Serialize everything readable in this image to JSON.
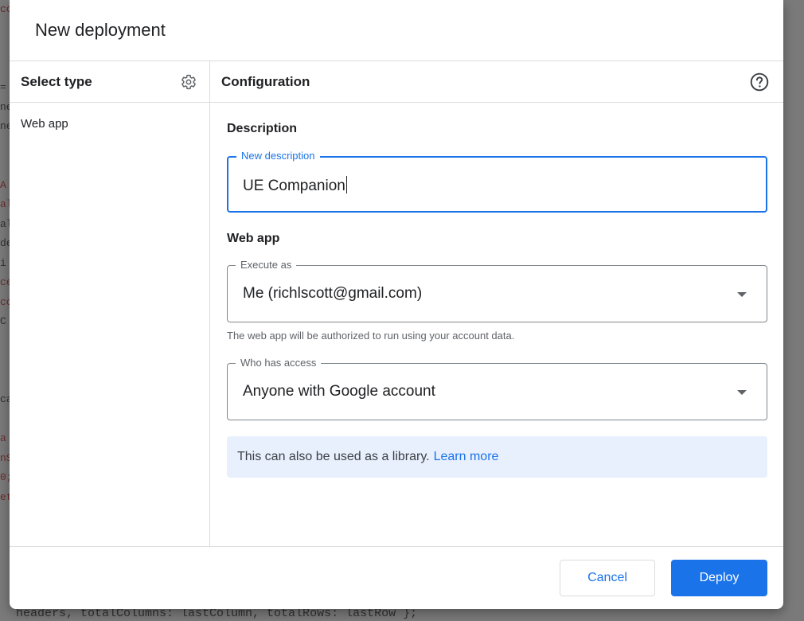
{
  "dialog": {
    "title": "New deployment"
  },
  "left_pane": {
    "title": "Select type",
    "settings_icon": "gear-icon",
    "types": [
      {
        "label": "Web app"
      }
    ]
  },
  "right_pane": {
    "title": "Configuration",
    "help_icon": "help-circle-icon",
    "description_section": {
      "heading": "Description",
      "field_label": "New description",
      "field_value": "UE Companion"
    },
    "web_app_section": {
      "heading": "Web app",
      "execute_as": {
        "label": "Execute as",
        "value": "Me (richlscott@gmail.com)"
      },
      "execute_helper": "The web app will be authorized to run using your account data.",
      "who_has_access": {
        "label": "Who has access",
        "value": "Anyone with Google account"
      }
    },
    "info": {
      "text": "This can also be used as a library.",
      "link": "Learn more"
    }
  },
  "footer": {
    "cancel_label": "Cancel",
    "deploy_label": "Deploy"
  },
  "backdrop": {
    "bottom_code_line": "  headers, totalColumns: lastColumn, totalRows: lastRow };",
    "side_code_fragments": [
      "cc",
      "",
      "",
      "",
      "=",
      "ne",
      "ne",
      "",
      "",
      "A",
      "al",
      "al",
      "de",
      "i",
      "ce",
      "co",
      "C",
      "",
      "",
      "",
      "ca",
      "",
      "a",
      "nS",
      "0;",
      "et",
      ""
    ]
  },
  "colors": {
    "accent": "#1a73e8",
    "info_bg": "#e8f0fe",
    "border": "#dadce0",
    "overlay": "#7a7a7a"
  }
}
